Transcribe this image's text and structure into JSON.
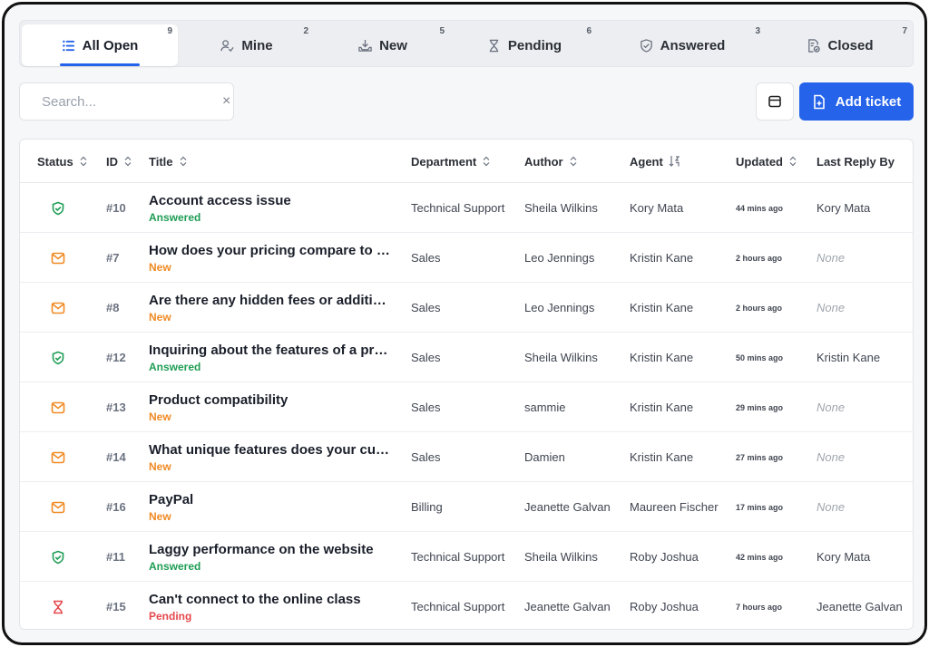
{
  "tabs": [
    {
      "label": "All Open",
      "count": "9",
      "icon": "list-icon",
      "active": true
    },
    {
      "label": "Mine",
      "count": "2",
      "icon": "user-check-icon",
      "active": false
    },
    {
      "label": "New",
      "count": "5",
      "icon": "inbox-download-icon",
      "active": false
    },
    {
      "label": "Pending",
      "count": "6",
      "icon": "hourglass-icon",
      "active": false
    },
    {
      "label": "Answered",
      "count": "3",
      "icon": "shield-check-icon",
      "active": false
    },
    {
      "label": "Closed",
      "count": "7",
      "icon": "document-check-icon",
      "active": false
    }
  ],
  "toolbar": {
    "search_placeholder": "Search...",
    "clear_symbol": "×",
    "add_ticket_label": "Add ticket"
  },
  "columns": {
    "status": "Status",
    "id": "ID",
    "title": "Title",
    "department": "Department",
    "author": "Author",
    "agent": "Agent",
    "updated": "Updated",
    "last_reply": "Last Reply By"
  },
  "colors": {
    "answered": "#1f9d55",
    "new": "#f08a24",
    "pending": "#e5484d",
    "accent": "#2563eb"
  },
  "rows": [
    {
      "status": "answered",
      "status_label": "Answered",
      "id": "#10",
      "title": "Account access issue",
      "department": "Technical Support",
      "author": "Sheila Wilkins",
      "agent": "Kory Mata",
      "updated": "44 mins ago",
      "last_reply": "Kory Mata"
    },
    {
      "status": "new",
      "status_label": "New",
      "id": "#7",
      "title": "How does your pricing compare to your competitors?",
      "department": "Sales",
      "author": "Leo Jennings",
      "agent": "Kristin Kane",
      "updated": "2 hours ago",
      "last_reply": "None"
    },
    {
      "status": "new",
      "status_label": "New",
      "id": "#8",
      "title": "Are there any hidden fees or additional charges?",
      "department": "Sales",
      "author": "Leo Jennings",
      "agent": "Kristin Kane",
      "updated": "2 hours ago",
      "last_reply": "None"
    },
    {
      "status": "answered",
      "status_label": "Answered",
      "id": "#12",
      "title": "Inquiring about the features of a product",
      "department": "Sales",
      "author": "Sheila Wilkins",
      "agent": "Kristin Kane",
      "updated": "50 mins ago",
      "last_reply": "Kristin Kane"
    },
    {
      "status": "new",
      "status_label": "New",
      "id": "#13",
      "title": "Product compatibility",
      "department": "Sales",
      "author": "sammie",
      "agent": "Kristin Kane",
      "updated": "29 mins ago",
      "last_reply": "None"
    },
    {
      "status": "new",
      "status_label": "New",
      "id": "#14",
      "title": "What unique features does your customer service offer?",
      "department": "Sales",
      "author": "Damien",
      "agent": "Kristin Kane",
      "updated": "27 mins ago",
      "last_reply": "None"
    },
    {
      "status": "new",
      "status_label": "New",
      "id": "#16",
      "title": "PayPal",
      "department": "Billing",
      "author": "Jeanette Galvan",
      "agent": "Maureen Fischer",
      "updated": "17 mins ago",
      "last_reply": "None"
    },
    {
      "status": "answered",
      "status_label": "Answered",
      "id": "#11",
      "title": "Laggy performance on the website",
      "department": "Technical Support",
      "author": "Sheila Wilkins",
      "agent": "Roby Joshua",
      "updated": "42 mins ago",
      "last_reply": "Kory Mata"
    },
    {
      "status": "pending",
      "status_label": "Pending",
      "id": "#15",
      "title": "Can't connect to the online class",
      "department": "Technical Support",
      "author": "Jeanette Galvan",
      "agent": "Roby Joshua",
      "updated": "7 hours ago",
      "last_reply": "Jeanette Galvan"
    }
  ]
}
